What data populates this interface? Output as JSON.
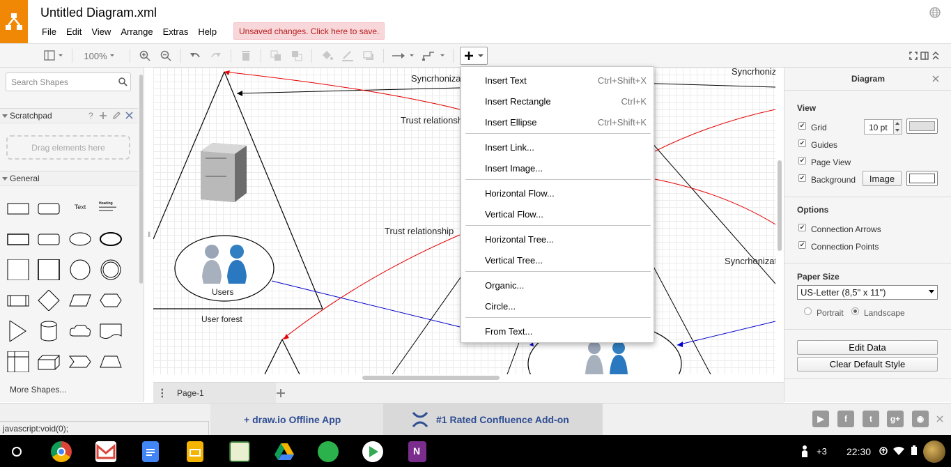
{
  "app": {
    "title": "Untitled Diagram.xml",
    "menu": [
      "File",
      "Edit",
      "View",
      "Arrange",
      "Extras",
      "Help"
    ],
    "unsaved": "Unsaved changes. Click here to save.",
    "accent": "#f08705"
  },
  "toolbar": {
    "zoom": "100%",
    "icons": [
      "page-view-icon",
      "zoom-in-icon",
      "zoom-out-icon",
      "undo-icon",
      "redo-icon",
      "delete-icon",
      "to-front-icon",
      "to-back-icon",
      "fill-color-icon",
      "line-color-icon",
      "shadow-icon",
      "connection-icon",
      "waypoints-icon",
      "insert-plus-icon",
      "fullscreen-icon",
      "format-panel-icon",
      "collapse-icon"
    ]
  },
  "sidebar": {
    "search_placeholder": "Search Shapes",
    "scratchpad": "Scratchpad",
    "scratchpad_help": "?",
    "drag_here": "Drag elements here",
    "general": "General",
    "text_shape": "Text",
    "heading_shape": "Heading",
    "more_shapes": "More Shapes..."
  },
  "canvas": {
    "labels": {
      "sync1": "Syncrhonization",
      "sync2": "Syncrhonization",
      "sync3": "Syncrhonization",
      "trust1": "Trust relationship",
      "trust2": "Trust relationship",
      "users": "Users",
      "user_forest": "User forest"
    }
  },
  "insert_menu": {
    "items": [
      {
        "label": "Insert Text",
        "shortcut": "Ctrl+Shift+X"
      },
      {
        "label": "Insert Rectangle",
        "shortcut": "Ctrl+K"
      },
      {
        "label": "Insert Ellipse",
        "shortcut": "Ctrl+Shift+K"
      },
      {
        "label": "Insert Link...",
        "shortcut": ""
      },
      {
        "label": "Insert Image...",
        "shortcut": ""
      },
      {
        "label": "Horizontal Flow...",
        "shortcut": ""
      },
      {
        "label": "Vertical Flow...",
        "shortcut": ""
      },
      {
        "label": "Horizontal Tree...",
        "shortcut": ""
      },
      {
        "label": "Vertical Tree...",
        "shortcut": ""
      },
      {
        "label": "Organic...",
        "shortcut": ""
      },
      {
        "label": "Circle...",
        "shortcut": ""
      },
      {
        "label": "From Text...",
        "shortcut": ""
      }
    ]
  },
  "page_tab": {
    "name": "Page-1"
  },
  "format_panel": {
    "title": "Diagram",
    "view_heading": "View",
    "grid": "Grid",
    "grid_size": "10 pt",
    "guides": "Guides",
    "page_view": "Page View",
    "background": "Background",
    "image_button": "Image",
    "options_heading": "Options",
    "connection_arrows": "Connection Arrows",
    "connection_points": "Connection Points",
    "paper_size_heading": "Paper Size",
    "paper_size": "US-Letter (8,5\" x 11\")",
    "portrait": "Portrait",
    "landscape": "Landscape",
    "edit_data": "Edit Data",
    "clear_style": "Clear Default Style"
  },
  "status_bar": {
    "text": "javascript:void(0);"
  },
  "ads": {
    "offline": "+ draw.io Offline App",
    "confluence": "#1 Rated Confluence Add-on"
  },
  "taskbar": {
    "notif": "+3",
    "clock": "22:30"
  }
}
